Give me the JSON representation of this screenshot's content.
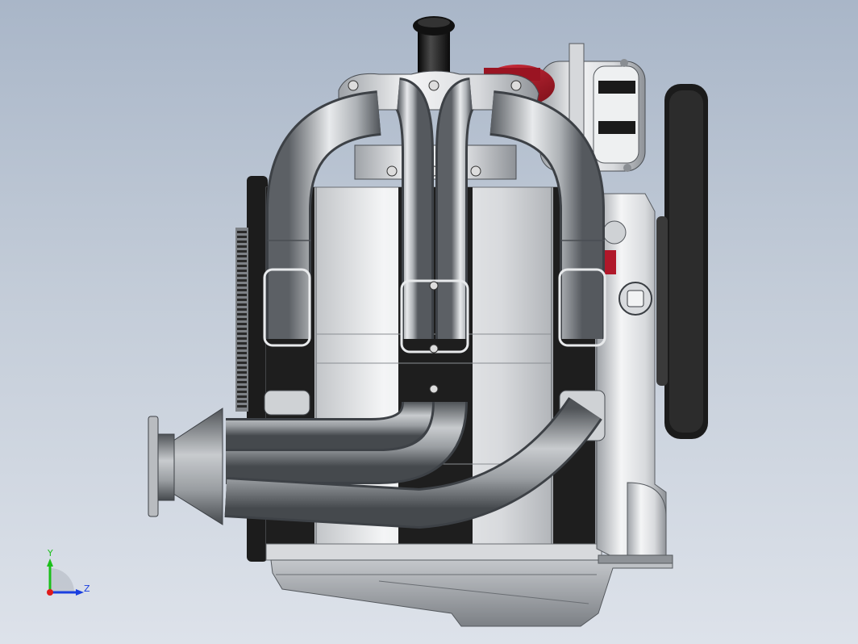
{
  "viewport": {
    "background_top": "#a9b6c8",
    "background_bottom": "#dde2ea"
  },
  "model": {
    "colors": {
      "metal": "#c9ccd0",
      "block_dark": "#1e1e1e",
      "cap": "#141414",
      "filter_red": "#b0182a",
      "pulley": "#1b1b1b"
    }
  },
  "triad": {
    "y_label": "Y",
    "z_label": "Z",
    "y_color": "#1bbf1b",
    "z_color": "#1a3fe0",
    "x_color": "#e01a1a"
  }
}
